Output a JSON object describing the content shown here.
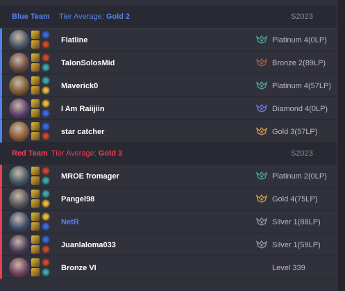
{
  "teams": [
    {
      "name": "Blue Team",
      "tier_label": "Tier Average:",
      "tier_value": "Gold 2",
      "season": "S2023",
      "color": "#5383e8"
    },
    {
      "name": "Red Team",
      "tier_label": "Tier Average:",
      "tier_value": "Gold 3",
      "season": "S2023",
      "color": "#e84057"
    }
  ],
  "players": [
    {
      "name": "Flatline",
      "rank": "Platinum 4(0LP)",
      "tier_color": "#4ba59a",
      "champ_color": "#4a5466"
    },
    {
      "name": "TalonSolosMid",
      "rank": "Bronze 2(89LP)",
      "tier_color": "#a0603f",
      "champ_color": "#6b4a3e"
    },
    {
      "name": "Maverick0",
      "rank": "Platinum 4(57LP)",
      "tier_color": "#4ba59a",
      "champ_color": "#7a5a2e"
    },
    {
      "name": "I Am Raiijiin",
      "rank": "Diamond 4(0LP)",
      "tier_color": "#6b78d6",
      "champ_color": "#5a3f6e"
    },
    {
      "name": "star catcher",
      "rank": "Gold 3(57LP)",
      "tier_color": "#d39a3c",
      "champ_color": "#8a5a30"
    },
    {
      "name": "MROE fromager",
      "rank": "Platinum 2(0LP)",
      "tier_color": "#4ba59a",
      "champ_color": "#3e5a66"
    },
    {
      "name": "Pangel98",
      "rank": "Gold 4(75LP)",
      "tier_color": "#d39a3c",
      "champ_color": "#55565a"
    },
    {
      "name": "NetR",
      "rank": "Silver 1(88LP)",
      "tier_color": "#8c98a0",
      "champ_color": "#3c4d6e"
    },
    {
      "name": "Juanlaloma033",
      "rank": "Silver 1(59LP)",
      "tier_color": "#8c98a0",
      "champ_color": "#4a3a5a"
    },
    {
      "name": "Bronze VI",
      "rank": "Level 339",
      "tier_color": "",
      "champ_color": "#6e3e5a"
    }
  ]
}
